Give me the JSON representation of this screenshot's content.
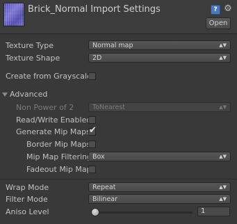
{
  "header": {
    "title": "Brick_Normal Import Settings",
    "open_label": "Open",
    "help_icon": "help-icon",
    "gear_icon": "gear-icon"
  },
  "fields": {
    "texture_type": {
      "label": "Texture Type",
      "value": "Normal map"
    },
    "texture_shape": {
      "label": "Texture Shape",
      "value": "2D"
    },
    "create_from_grayscale": {
      "label": "Create from Grayscale",
      "checked": false
    },
    "advanced": {
      "label": "Advanced",
      "expanded": true
    },
    "non_power_of_2": {
      "label": "Non Power of 2",
      "value": "ToNearest",
      "disabled": true
    },
    "read_write_enabled": {
      "label": "Read/Write Enabled",
      "checked": false
    },
    "generate_mip_maps": {
      "label": "Generate Mip Maps",
      "checked": true
    },
    "border_mip_maps": {
      "label": "Border Mip Maps",
      "checked": false
    },
    "mip_map_filtering": {
      "label": "Mip Map Filtering",
      "value": "Box"
    },
    "fadeout_mip_maps": {
      "label": "Fadeout Mip Maps",
      "checked": false
    },
    "wrap_mode": {
      "label": "Wrap Mode",
      "value": "Repeat"
    },
    "filter_mode": {
      "label": "Filter Mode",
      "value": "Bilinear"
    },
    "aniso_level": {
      "label": "Aniso Level",
      "value": "1"
    }
  },
  "colors": {
    "background": "#393939",
    "header": "#3c3c3c",
    "text": "#c2c2c2",
    "disabled_text": "#7a7a7a"
  }
}
